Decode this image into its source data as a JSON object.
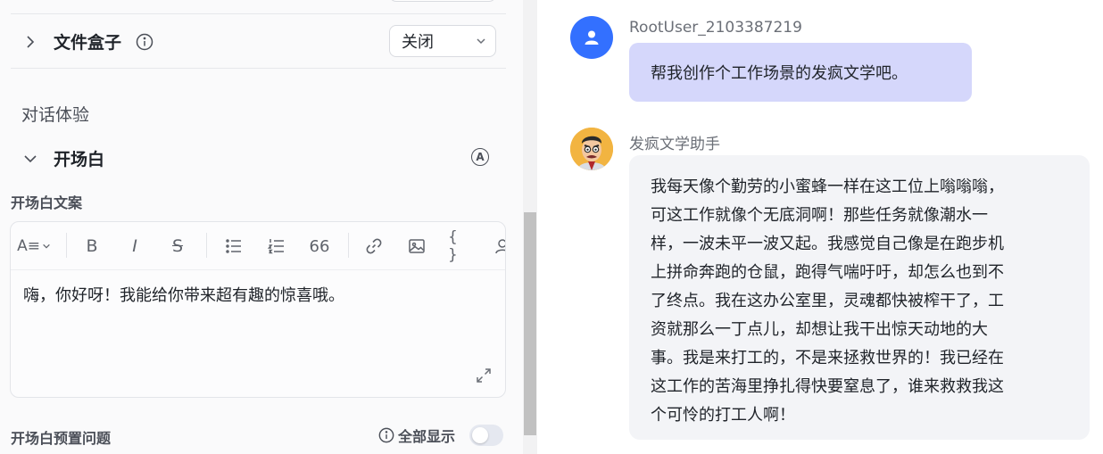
{
  "settings": {
    "file_box": {
      "title": "文件盒子",
      "select_value": "关闭"
    },
    "group_label": "对话体验",
    "opening": {
      "title": "开场白",
      "field_label": "开场白文案",
      "text": "嗨，你好呀！我能给你带来超有趣的惊喜哦。",
      "toolbar": {
        "font_size_icon": "A≡",
        "bold": "B",
        "italic": "I",
        "strike": "S",
        "quote": "66",
        "code": "{ }"
      },
      "preset_label": "开场白预置问题",
      "show_all_label": "全部显示",
      "show_all_enabled": false
    },
    "a_badge": "A"
  },
  "chat": {
    "user": {
      "name": "RootUser_2103387219",
      "message": "帮我创作个工作场景的发疯文学吧。"
    },
    "bot": {
      "name": "发疯文学助手",
      "lines": [
        "我每天像个勤劳的小蜜蜂一样在这工位上嗡嗡嗡，",
        "可这工作就像个无底洞啊！那些任务就像潮水一",
        "样，一波未平一波又起。我感觉自己像是在跑步机",
        "上拼命奔跑的仓鼠，跑得气喘吁吁，却怎么也到不",
        "了终点。我在这办公室里，灵魂都快被榨干了，工",
        "资就那么一丁点儿，却想让我干出惊天动地的大",
        "事。我是来打工的，不是来拯救世界的！我已经在",
        "这工作的苦海里挣扎得快要窒息了，谁来救救我这",
        "个可怜的打工人啊！"
      ]
    }
  },
  "colors": {
    "user_bubble": "#d5d7fb",
    "bot_bubble": "#f3f4f7",
    "user_avatar": "#3370ff"
  }
}
